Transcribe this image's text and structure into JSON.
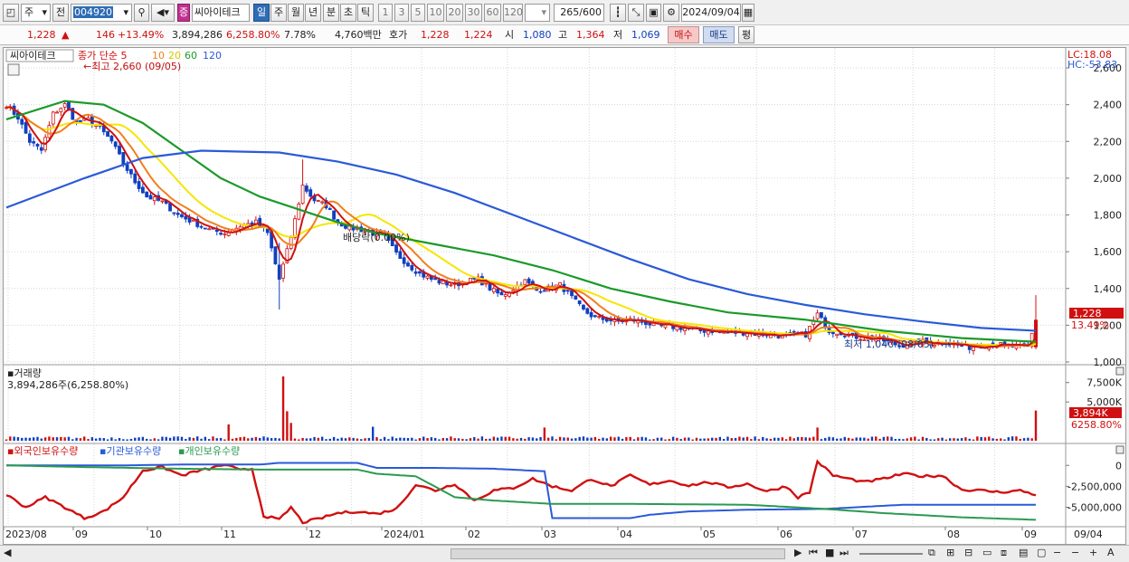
{
  "toolbar": {
    "period_type": "주",
    "prev_label": "전",
    "stock_code": "004920",
    "stock_name": "씨아이테크",
    "badge": "증",
    "periods": [
      "일",
      "주",
      "월",
      "년",
      "분",
      "초",
      "틱"
    ],
    "active_period": "일",
    "intervals": [
      "1",
      "3",
      "5",
      "10",
      "20",
      "30",
      "60",
      "120"
    ],
    "count_value": "265",
    "count_total": "/600",
    "date": "2024/09/04"
  },
  "quote": {
    "price": "1,228",
    "change": "146",
    "change_pct": "+13.49%",
    "volume": "3,894,286",
    "volume_pct": "6,258.80%",
    "turnover": "7.78%",
    "amount": "4,760백만",
    "ask_label": "호가",
    "ask": "1,228",
    "bid": "1,224",
    "open_label": "시",
    "open": "1,080",
    "high_label": "고",
    "high": "1,364",
    "low_label": "저",
    "low": "1,069",
    "buy_label": "매수",
    "sell_label": "매도",
    "eval_label": "평"
  },
  "price_panel": {
    "stock_label": "씨아이테크",
    "legend_prefix": "종가 단순",
    "ma_periods": [
      "5",
      "10",
      "20",
      "60",
      "120"
    ],
    "high_marker": "최고 2,660 (09/05)",
    "low_marker": "최저 1,040 (08/05)",
    "dividend_marker": "배당락(0.00%)",
    "lc": "LC:18.08",
    "hc": "HC:-53.83",
    "current_price_tag": "1,228",
    "current_pct_tag": "13.49%"
  },
  "volume_panel": {
    "title": "거래량",
    "info": "3,894,286주(6,258.80%)",
    "current_tag": "3,894K",
    "current_pct_tag": "6258.80%"
  },
  "holdings_panel": {
    "legend": [
      "외국인보유수량",
      "기관보유수량",
      "개인보유수량"
    ]
  },
  "x_labels": [
    "2023/08",
    "09",
    "10",
    "11",
    "12",
    "2024/01",
    "02",
    "03",
    "04",
    "05",
    "06",
    "07",
    "08",
    "09"
  ],
  "x_end_label": "09/04",
  "colors": {
    "ma5": "#d01010",
    "ma10": "#f08020",
    "ma20": "#f5e600",
    "ma60": "#1a9a2a",
    "ma120": "#2a5ad8",
    "up": "#d01010",
    "down": "#1040c0",
    "foreign": "#d01010",
    "institution": "#2a5ad8",
    "individual": "#2a9a50"
  },
  "chart_data": [
    {
      "type": "candlestick",
      "title": "씨아이테크",
      "ylim": [
        1000,
        2620
      ],
      "yticks": [
        "1,000",
        "1,200",
        "1,400",
        "1,600",
        "1,800",
        "2,000",
        "2,200",
        "2,400",
        "2,600"
      ],
      "ytick_values": [
        1000,
        1200,
        1400,
        1600,
        1800,
        2000,
        2200,
        2400,
        2600
      ],
      "close_points": [
        [
          0,
          2400
        ],
        [
          3,
          2330
        ],
        [
          6,
          2200
        ],
        [
          9,
          2150
        ],
        [
          12,
          2350
        ],
        [
          15,
          2400
        ],
        [
          18,
          2300
        ],
        [
          21,
          2320
        ],
        [
          24,
          2270
        ],
        [
          27,
          2200
        ],
        [
          30,
          2080
        ],
        [
          33,
          1980
        ],
        [
          36,
          1900
        ],
        [
          40,
          1870
        ],
        [
          44,
          1800
        ],
        [
          48,
          1760
        ],
        [
          52,
          1720
        ],
        [
          56,
          1700
        ],
        [
          60,
          1740
        ],
        [
          64,
          1760
        ],
        [
          67,
          1700
        ],
        [
          70,
          1450
        ],
        [
          73,
          1680
        ],
        [
          76,
          1960
        ],
        [
          79,
          1880
        ],
        [
          82,
          1850
        ],
        [
          85,
          1760
        ],
        [
          88,
          1730
        ],
        [
          91,
          1720
        ],
        [
          94,
          1700
        ],
        [
          97,
          1680
        ],
        [
          100,
          1590
        ],
        [
          103,
          1530
        ],
        [
          106,
          1480
        ],
        [
          109,
          1450
        ],
        [
          112,
          1430
        ],
        [
          115,
          1420
        ],
        [
          118,
          1440
        ],
        [
          121,
          1450
        ],
        [
          124,
          1400
        ],
        [
          127,
          1360
        ],
        [
          130,
          1400
        ],
        [
          133,
          1440
        ],
        [
          136,
          1390
        ],
        [
          139,
          1400
        ],
        [
          142,
          1420
        ],
        [
          145,
          1350
        ],
        [
          148,
          1280
        ],
        [
          151,
          1240
        ],
        [
          154,
          1230
        ],
        [
          157,
          1220
        ],
        [
          160,
          1230
        ],
        [
          163,
          1220
        ],
        [
          166,
          1200
        ],
        [
          169,
          1190
        ],
        [
          172,
          1190
        ],
        [
          175,
          1180
        ],
        [
          178,
          1170
        ],
        [
          181,
          1170
        ],
        [
          184,
          1160
        ],
        [
          187,
          1160
        ],
        [
          190,
          1160
        ],
        [
          193,
          1150
        ],
        [
          196,
          1150
        ],
        [
          199,
          1140
        ],
        [
          202,
          1150
        ],
        [
          205,
          1150
        ],
        [
          208,
          1260
        ],
        [
          211,
          1170
        ],
        [
          214,
          1160
        ],
        [
          217,
          1140
        ],
        [
          220,
          1130
        ],
        [
          223,
          1130
        ],
        [
          226,
          1110
        ],
        [
          229,
          1090
        ],
        [
          232,
          1100
        ],
        [
          235,
          1110
        ],
        [
          238,
          1100
        ],
        [
          241,
          1110
        ],
        [
          244,
          1090
        ],
        [
          247,
          1080
        ],
        [
          250,
          1090
        ],
        [
          253,
          1100
        ],
        [
          256,
          1090
        ],
        [
          259,
          1082
        ],
        [
          262,
          1080
        ],
        [
          264,
          1228
        ]
      ],
      "ma60_points": [
        [
          0,
          2320
        ],
        [
          15,
          2420
        ],
        [
          25,
          2400
        ],
        [
          35,
          2300
        ],
        [
          45,
          2150
        ],
        [
          55,
          2000
        ],
        [
          65,
          1900
        ],
        [
          75,
          1830
        ],
        [
          85,
          1760
        ],
        [
          95,
          1700
        ],
        [
          110,
          1640
        ],
        [
          125,
          1580
        ],
        [
          140,
          1500
        ],
        [
          155,
          1400
        ],
        [
          170,
          1330
        ],
        [
          185,
          1270
        ],
        [
          205,
          1230
        ],
        [
          225,
          1170
        ],
        [
          245,
          1130
        ],
        [
          264,
          1110
        ]
      ],
      "ma120_points": [
        [
          0,
          1840
        ],
        [
          20,
          2000
        ],
        [
          35,
          2110
        ],
        [
          50,
          2150
        ],
        [
          70,
          2140
        ],
        [
          85,
          2090
        ],
        [
          100,
          2020
        ],
        [
          115,
          1920
        ],
        [
          130,
          1800
        ],
        [
          145,
          1680
        ],
        [
          160,
          1560
        ],
        [
          175,
          1450
        ],
        [
          190,
          1370
        ],
        [
          205,
          1310
        ],
        [
          220,
          1260
        ],
        [
          235,
          1220
        ],
        [
          250,
          1185
        ],
        [
          264,
          1170
        ]
      ],
      "annotations": [
        "최고 2,660 (09/05)",
        "최저 1,040 (08/05)",
        "배당락(0.00%)"
      ]
    },
    {
      "type": "bar",
      "title": "거래량",
      "ylim": [
        0,
        8400
      ],
      "yticks": [
        "5,000K",
        "7,500K"
      ],
      "ytick_values": [
        5000,
        7500
      ],
      "spikes": [
        [
          57,
          2100
        ],
        [
          71,
          8300
        ],
        [
          72,
          3800
        ],
        [
          73,
          2300
        ],
        [
          94,
          1800
        ],
        [
          138,
          1700
        ],
        [
          208,
          1700
        ],
        [
          264,
          3894
        ]
      ],
      "baseline": 400
    },
    {
      "type": "line",
      "title": "외국인보유수량 / 기관보유수량 / 개인보유수량",
      "ylim": [
        -7000000,
        1000000
      ],
      "yticks": [
        "0",
        "-2,500,000",
        "-5,000,000"
      ],
      "ytick_values": [
        0,
        -2500000,
        -5000000
      ],
      "series": [
        {
          "name": "외국인보유수량",
          "points": [
            [
              0,
              -3500000
            ],
            [
              5,
              -5000000
            ],
            [
              10,
              -3800000
            ],
            [
              15,
              -5000000
            ],
            [
              20,
              -6300000
            ],
            [
              25,
              -5500000
            ],
            [
              30,
              -3800000
            ],
            [
              35,
              -600000
            ],
            [
              40,
              -200000
            ],
            [
              45,
              -1200000
            ],
            [
              48,
              -800000
            ],
            [
              52,
              -400000
            ],
            [
              56,
              100000
            ],
            [
              60,
              -600000
            ],
            [
              63,
              -400000
            ],
            [
              66,
              -6000000
            ],
            [
              70,
              -6500000
            ],
            [
              73,
              -5000000
            ],
            [
              76,
              -6800000
            ],
            [
              80,
              -6400000
            ],
            [
              85,
              -5700000
            ],
            [
              90,
              -5500000
            ],
            [
              95,
              -5800000
            ],
            [
              100,
              -5200000
            ],
            [
              105,
              -2300000
            ],
            [
              110,
              -3000000
            ],
            [
              115,
              -2200000
            ],
            [
              120,
              -4200000
            ],
            [
              125,
              -3000000
            ],
            [
              130,
              -2700000
            ],
            [
              135,
              -1600000
            ],
            [
              140,
              -2500000
            ],
            [
              145,
              -3000000
            ],
            [
              150,
              -1600000
            ],
            [
              155,
              -2500000
            ],
            [
              160,
              -1200000
            ],
            [
              165,
              -2300000
            ],
            [
              170,
              -1800000
            ],
            [
              175,
              -2400000
            ],
            [
              180,
              -2000000
            ],
            [
              185,
              -2600000
            ],
            [
              190,
              -2200000
            ],
            [
              195,
              -3100000
            ],
            [
              200,
              -2500000
            ],
            [
              203,
              -3800000
            ],
            [
              206,
              -3200000
            ],
            [
              208,
              500000
            ],
            [
              212,
              -1200000
            ],
            [
              220,
              -2000000
            ],
            [
              225,
              -1600000
            ],
            [
              230,
              -1000000
            ],
            [
              235,
              -1300000
            ],
            [
              240,
              -1200000
            ],
            [
              245,
              -2900000
            ],
            [
              250,
              -3000000
            ],
            [
              255,
              -3200000
            ],
            [
              260,
              -3000000
            ],
            [
              264,
              -3500000
            ]
          ]
        },
        {
          "name": "기관보유수량",
          "points": [
            [
              0,
              0
            ],
            [
              30,
              0
            ],
            [
              45,
              100000
            ],
            [
              65,
              100000
            ],
            [
              70,
              300000
            ],
            [
              90,
              300000
            ],
            [
              95,
              -300000
            ],
            [
              110,
              -300000
            ],
            [
              125,
              -400000
            ],
            [
              138,
              -700000
            ],
            [
              140,
              -6300000
            ],
            [
              160,
              -6300000
            ],
            [
              165,
              -5900000
            ],
            [
              175,
              -5500000
            ],
            [
              190,
              -5300000
            ],
            [
              210,
              -5200000
            ],
            [
              230,
              -4700000
            ],
            [
              264,
              -4700000
            ]
          ]
        },
        {
          "name": "개인보유수량",
          "points": [
            [
              0,
              0
            ],
            [
              20,
              -200000
            ],
            [
              45,
              -400000
            ],
            [
              65,
              -500000
            ],
            [
              90,
              -500000
            ],
            [
              95,
              -1000000
            ],
            [
              105,
              -1300000
            ],
            [
              115,
              -3800000
            ],
            [
              125,
              -4200000
            ],
            [
              140,
              -4600000
            ],
            [
              160,
              -4600000
            ],
            [
              190,
              -4700000
            ],
            [
              210,
              -5200000
            ],
            [
              225,
              -5700000
            ],
            [
              245,
              -6200000
            ],
            [
              264,
              -6500000
            ]
          ]
        }
      ]
    }
  ]
}
